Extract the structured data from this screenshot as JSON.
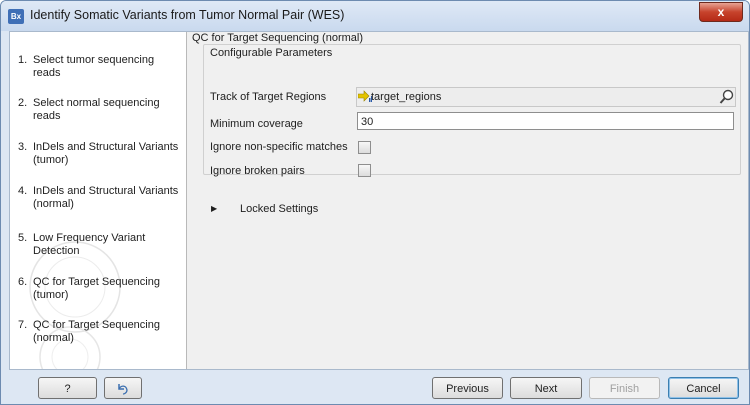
{
  "window": {
    "app_icon": "Bx",
    "title": "Identify Somatic Variants from Tumor Normal Pair (WES)",
    "close_label": "x"
  },
  "steps": [
    {
      "num": "1.",
      "label": "Select tumor sequencing reads"
    },
    {
      "num": "2.",
      "label": "Select normal sequencing reads"
    },
    {
      "num": "3.",
      "label": "InDels and Structural Variants (tumor)"
    },
    {
      "num": "4.",
      "label": "InDels and Structural Variants (normal)"
    },
    {
      "num": "5.",
      "label": "Low Frequency Variant Detection"
    },
    {
      "num": "6.",
      "label": "QC for Target Sequencing (tumor)"
    },
    {
      "num": "7.",
      "label": "QC for Target Sequencing (normal)"
    }
  ],
  "content": {
    "section_title": "QC for Target Sequencing (normal)",
    "group_title": "Configurable Parameters",
    "params": {
      "track_label": "Track of Target Regions",
      "track_value": "target_regions",
      "min_coverage_label": "Minimum coverage",
      "min_coverage_value": "30",
      "ignore_nonspecific_label": "Ignore non-specific matches",
      "ignore_broken_label": "Ignore broken pairs"
    },
    "locked_label": "Locked Settings"
  },
  "buttons": {
    "help": "?",
    "previous": "Previous",
    "next": "Next",
    "finish": "Finish",
    "cancel": "Cancel"
  },
  "icons": {
    "track": "track-icon",
    "browse": "browse-icon",
    "reset": "reset-icon",
    "expand": "triangle-right-icon"
  }
}
